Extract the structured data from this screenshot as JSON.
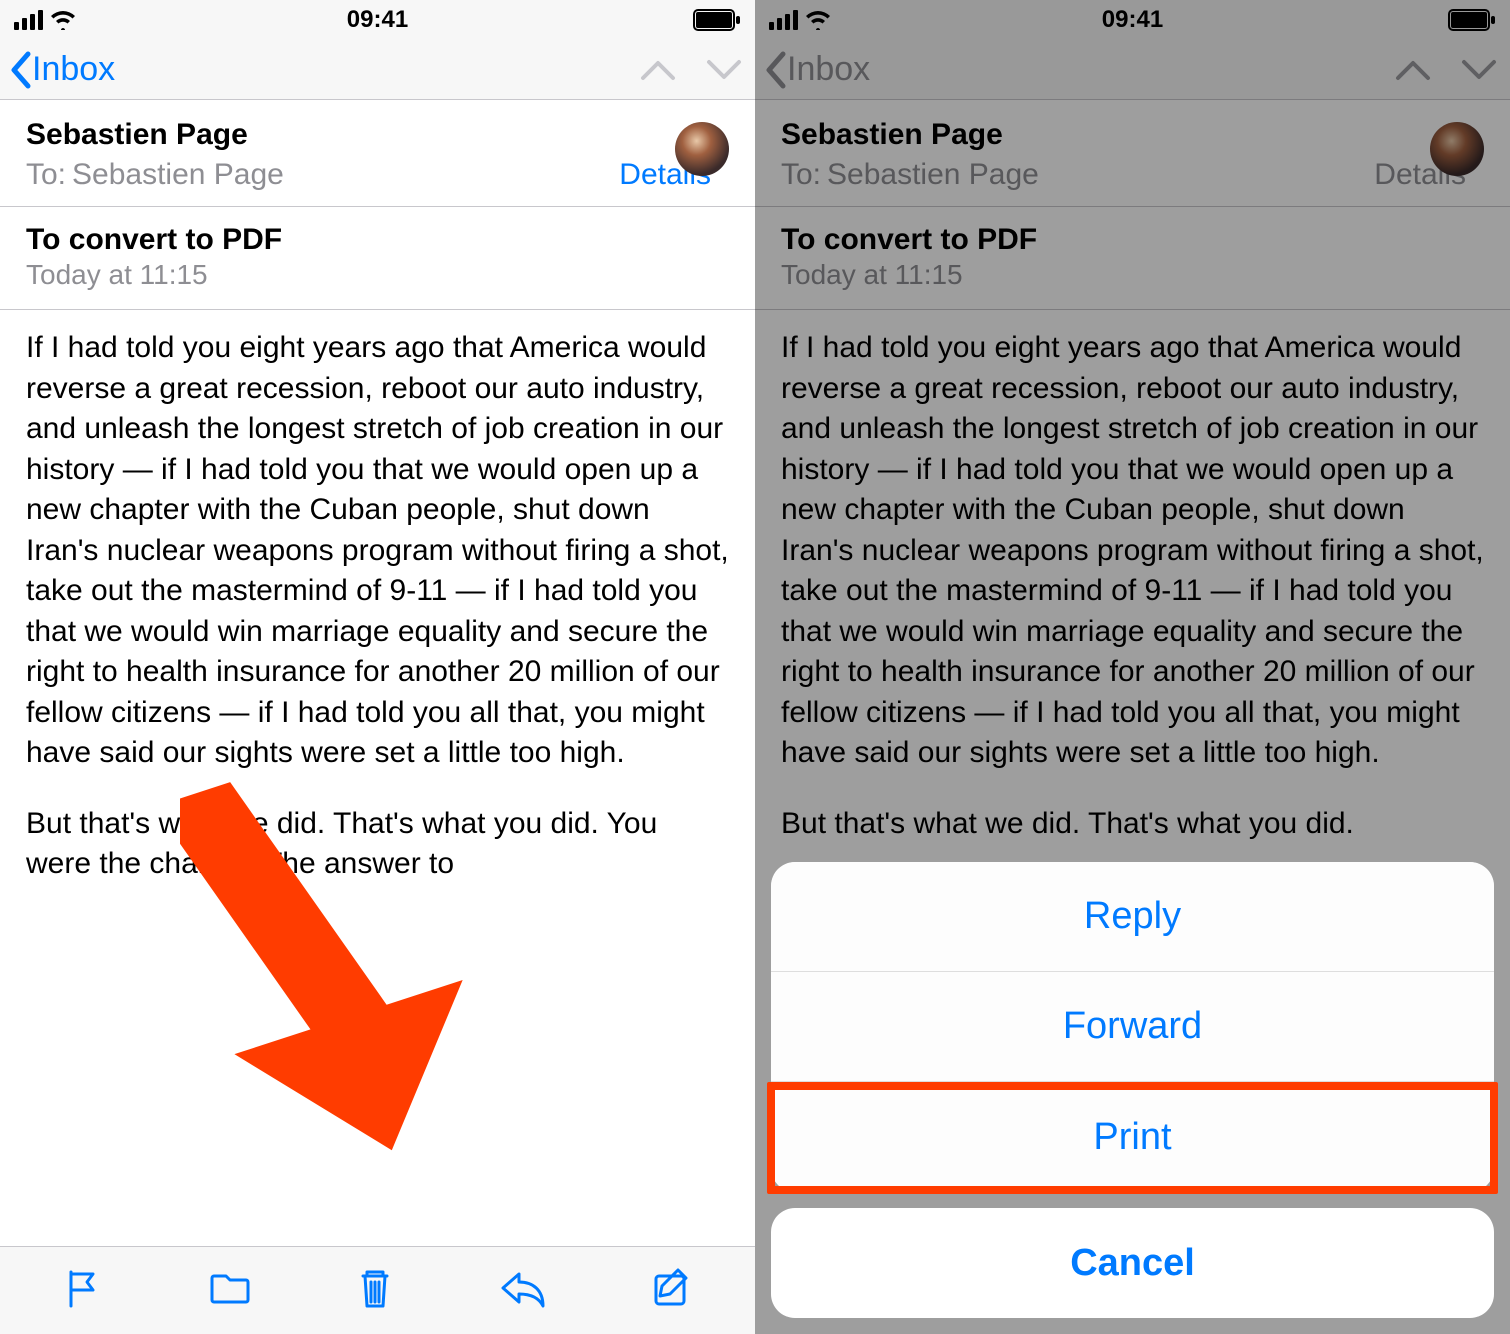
{
  "status": {
    "time": "09:41"
  },
  "nav": {
    "back_label": "Inbox"
  },
  "header": {
    "from": "Sebastien Page",
    "to_label": "To:",
    "to_name": "Sebastien Page",
    "details_label": "Details"
  },
  "subject": {
    "title": "To convert to PDF",
    "timestamp": "Today at 11:15"
  },
  "body": {
    "p1": "If I had told you eight years ago that America would reverse a great recession, reboot our auto industry, and unleash the longest stretch of job creation in our history — if I had told you that we would open up a new chapter with the Cuban people, shut down Iran's nuclear weapons program without firing a shot, take out the mastermind of 9-11 — if I had told you that we would win marriage equality and secure the right to health insurance for another 20 million of our fellow citizens — if I had told you all that, you might have said our sights were set a little too high.",
    "p2": "But that's what we did. That's what you did. You were the change. The answer to",
    "p2_short": "But that's what we did. That's what you did."
  },
  "sheet": {
    "reply": "Reply",
    "forward": "Forward",
    "print": "Print",
    "cancel": "Cancel"
  }
}
